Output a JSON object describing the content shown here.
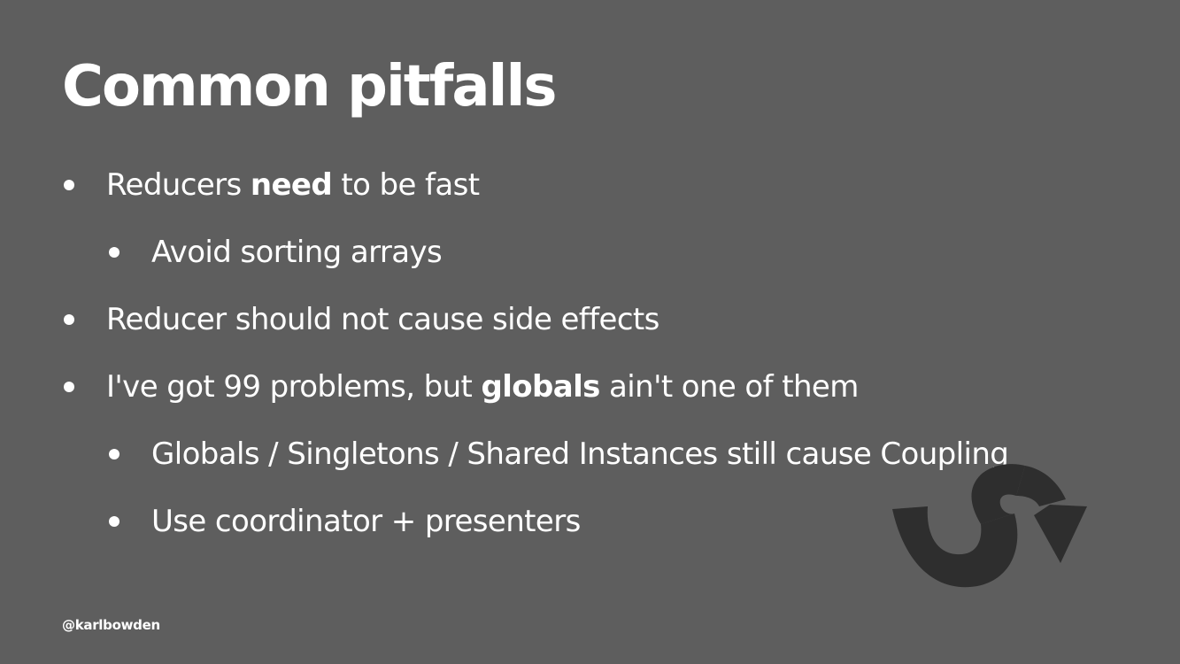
{
  "slide": {
    "title": "Common pitfalls",
    "bullets": [
      {
        "level": 1,
        "parts": [
          "Reducers ",
          "need",
          " to be fast"
        ]
      },
      {
        "level": 2,
        "text": "Avoid sorting arrays"
      },
      {
        "level": 1,
        "text": "Reducer should not cause side effects"
      },
      {
        "level": 1,
        "parts": [
          "I've got 99 problems, but ",
          "globals",
          " ain't one of them"
        ]
      },
      {
        "level": 2,
        "text": "Globals / Singletons / Shared Instances still cause Coupling"
      },
      {
        "level": 2,
        "text": "Use coordinator + presenters"
      }
    ],
    "footer": "@karlbowden",
    "logo_icon": "swift-s-arrow-logo-icon",
    "colors": {
      "background": "#5e5e5e",
      "text": "#ffffff",
      "logo": "#2e2e2e"
    }
  }
}
